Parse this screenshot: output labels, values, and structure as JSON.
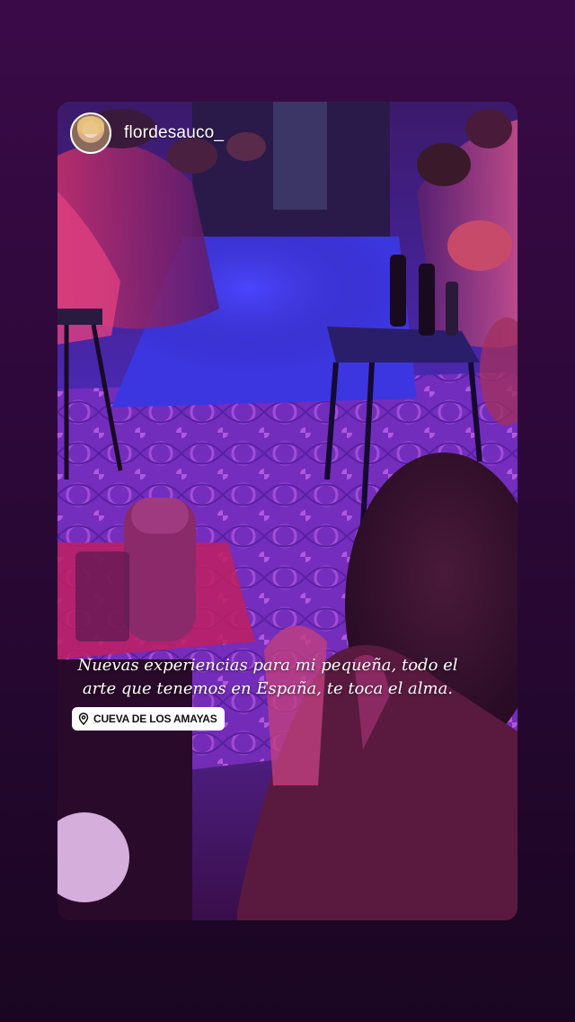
{
  "story": {
    "username": "flordesauco_",
    "caption": "Nuevas experiencias para mi pequeña, todo el arte que tenemos en España, te toca el alma.",
    "location": "CUEVA DE LOS AMAYAS"
  },
  "icons": {
    "avatar": "profile-photo",
    "location": "location-pin-icon"
  },
  "colors": {
    "background": "#2c0838",
    "stage_blue": "#3a34d6",
    "stage_pink": "#e0307a",
    "text": "#ffffff"
  }
}
